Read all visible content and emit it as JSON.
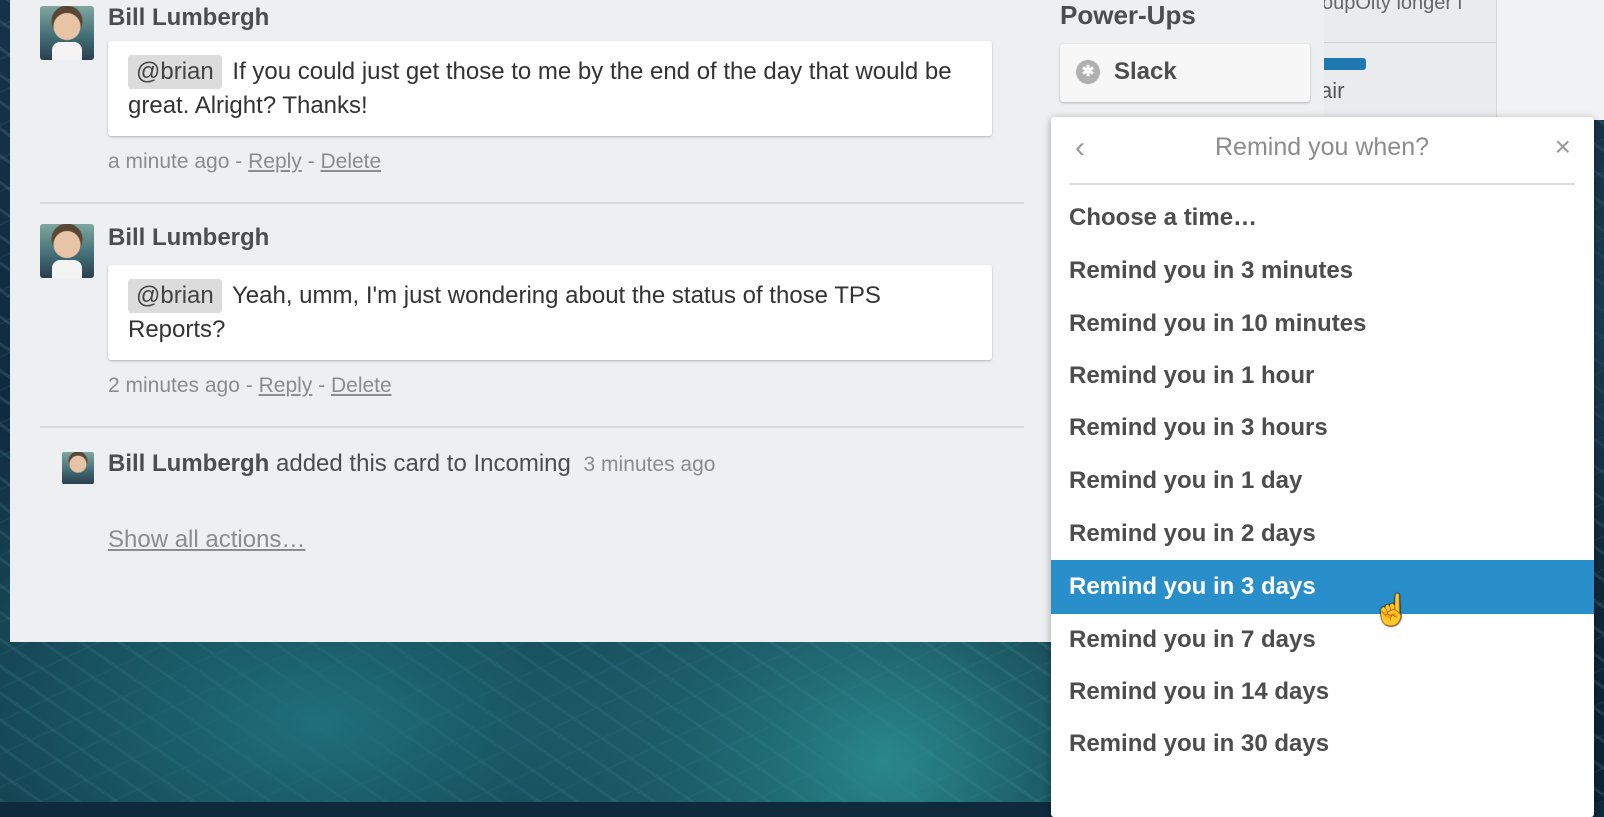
{
  "comments": [
    {
      "author": "Bill Lumbergh",
      "mention": "@brian",
      "text": "If you could just get those to me by the end of the day that would be great. Alright? Thanks!",
      "time": "a minute ago",
      "reply": "Reply",
      "delete": "Delete",
      "sep": " - "
    },
    {
      "author": "Bill Lumbergh",
      "mention": "@brian",
      "text": "Yeah, umm, I'm just wondering about the status of those TPS Reports?",
      "time": "2 minutes ago",
      "reply": "Reply",
      "delete": "Delete",
      "sep": " - "
    }
  ],
  "action": {
    "author": "Bill Lumbergh",
    "text": "added this card to Incoming",
    "time": "3 minutes ago"
  },
  "show_all": "Show all actions…",
  "powerups": {
    "title": "Power-Ups",
    "slack_label": "Slack",
    "slack_icon": "slack-icon"
  },
  "popover": {
    "title": "Remind you when?",
    "back_icon": "‹",
    "close_icon": "×",
    "options": [
      "Choose a time…",
      "Remind you in 3 minutes",
      "Remind you in 10 minutes",
      "Remind you in 1 hour",
      "Remind you in 3 hours",
      "Remind you in 1 day",
      "Remind you in 2 days",
      "Remind you in 3 days",
      "Remind you in 7 days",
      "Remind you in 14 days",
      "Remind you in 30 days"
    ],
    "selected_index": 7
  },
  "background_list": {
    "cut_text": "oupOity longer i",
    "partial_text": "air"
  },
  "colors": {
    "selected": "#298fca",
    "panel": "#edeff0"
  }
}
